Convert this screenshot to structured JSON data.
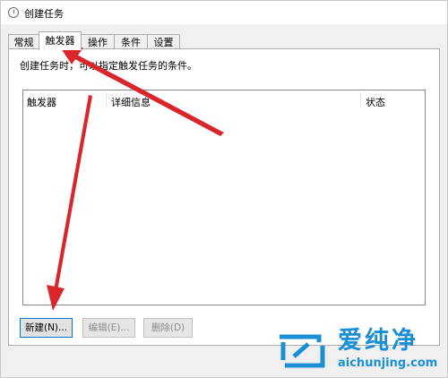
{
  "window": {
    "title": "创建任务"
  },
  "tabs": [
    {
      "label": "常规"
    },
    {
      "label": "触发器"
    },
    {
      "label": "操作"
    },
    {
      "label": "条件"
    },
    {
      "label": "设置"
    }
  ],
  "panel": {
    "description": "创建任务时，可以指定触发任务的条件。"
  },
  "table": {
    "columns": [
      "触发器",
      "详细信息",
      "状态"
    ],
    "rows": []
  },
  "buttons": {
    "new": "新建(N)...",
    "edit": "编辑(E)...",
    "delete": "删除(D)"
  },
  "watermark": {
    "brand_cn": "爱纯净",
    "brand_url": "aichunjing.com"
  },
  "colors": {
    "arrow": "#d9262b",
    "watermark": "#1a8fd6",
    "focus": "#0078d7"
  },
  "icons": {
    "title": "task-scheduler-icon",
    "watermark": "brand-logo-icon"
  }
}
